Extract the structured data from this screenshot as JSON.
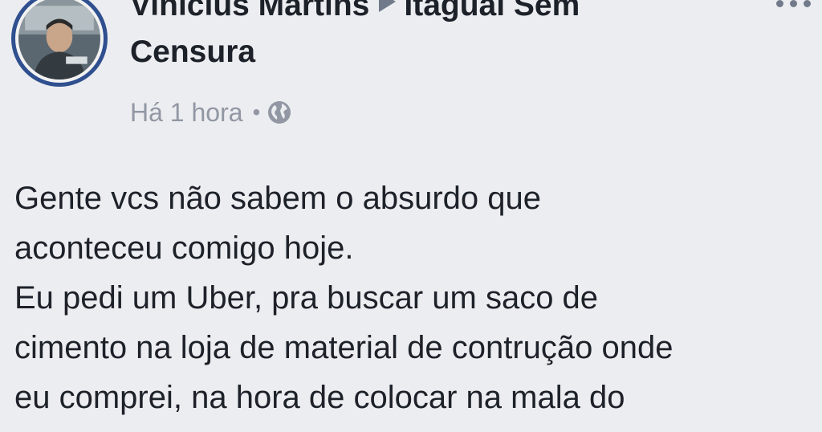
{
  "post": {
    "author": "Vinicius Martins",
    "group": "Itaguaí Sem Censura",
    "group_line1": "Itaguaí Sem",
    "group_line2": "Censura",
    "timestamp": "Há 1 hora",
    "separator": "•",
    "privacy_icon": "globe-icon",
    "avatar_icon": "profile-photo",
    "more_icon": "more-options-icon",
    "arrow_icon": "triangle-right-icon",
    "body_lines": [
      "Gente vcs não sabem o absurdo que",
      "aconteceu comigo hoje.",
      "Eu pedi um Uber, pra buscar um saco de",
      "cimento na loja de material de contrução onde",
      "eu comprei, na hora de colocar na mala do"
    ]
  },
  "colors": {
    "background": "#ecedf0",
    "text": "#1d2129",
    "meta_text": "#9197a3",
    "avatar_ring": "#2f4f8f"
  }
}
